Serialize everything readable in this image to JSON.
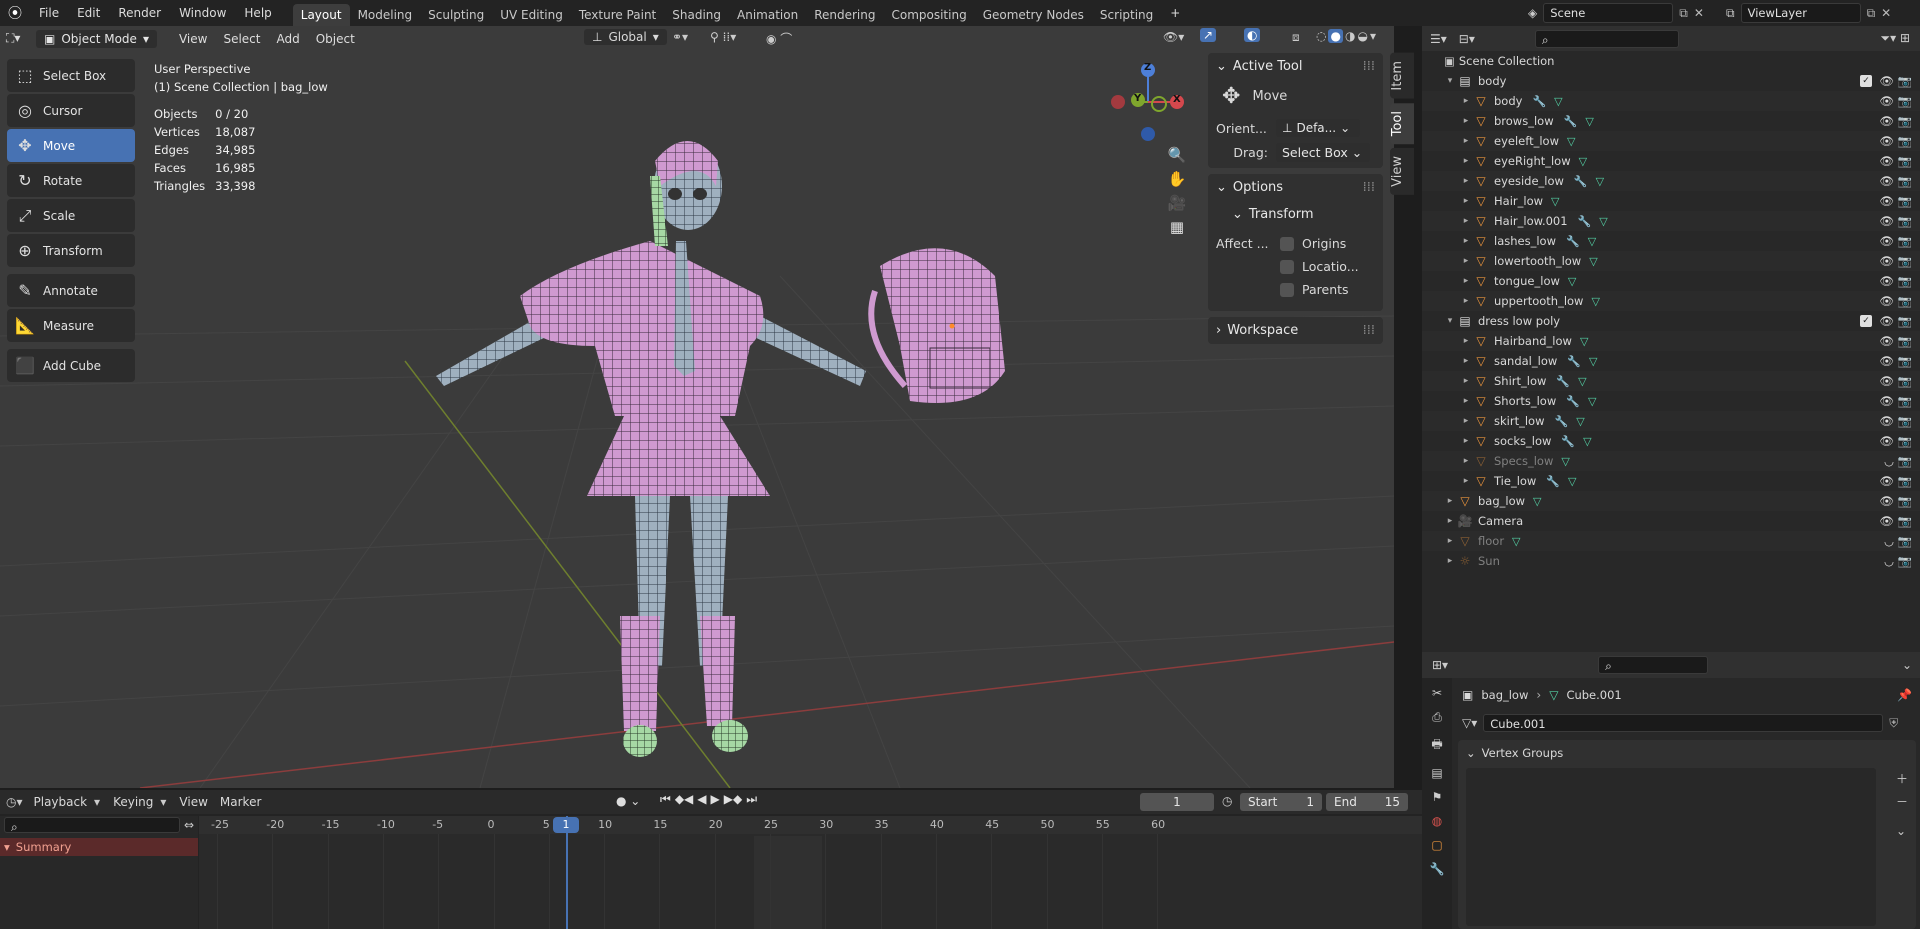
{
  "topbar": {
    "menus": [
      "File",
      "Edit",
      "Render",
      "Window",
      "Help"
    ],
    "workspaces": [
      "Layout",
      "Modeling",
      "Sculpting",
      "UV Editing",
      "Texture Paint",
      "Shading",
      "Animation",
      "Rendering",
      "Compositing",
      "Geometry Nodes",
      "Scripting"
    ],
    "active_workspace": "Layout",
    "add_tab": "+",
    "scene": "Scene",
    "view_layer": "ViewLayer"
  },
  "viewport": {
    "mode": "Object Mode",
    "menus": [
      "View",
      "Select",
      "Add",
      "Object"
    ],
    "orientation": "Global",
    "title": "User Perspective",
    "collection": "(1) Scene Collection | bag_low",
    "stats": [
      {
        "label": "Objects",
        "value": "0 / 20"
      },
      {
        "label": "Vertices",
        "value": "18,087"
      },
      {
        "label": "Edges",
        "value": "34,985"
      },
      {
        "label": "Faces",
        "value": "16,985"
      },
      {
        "label": "Triangles",
        "value": "33,398"
      }
    ],
    "gizmo": {
      "z": "Z",
      "y": "Y",
      "x": "X"
    }
  },
  "tools": [
    {
      "label": "Select Box",
      "icon": "select-box-icon",
      "glyph": "⬚",
      "active": false
    },
    {
      "label": "Cursor",
      "icon": "cursor-icon",
      "glyph": "◎",
      "active": false
    },
    {
      "label": "Move",
      "icon": "move-icon",
      "glyph": "✥",
      "active": true
    },
    {
      "label": "Rotate",
      "icon": "rotate-icon",
      "glyph": "↻",
      "active": false
    },
    {
      "label": "Scale",
      "icon": "scale-icon",
      "glyph": "⤢",
      "active": false
    },
    {
      "label": "Transform",
      "icon": "transform-icon",
      "glyph": "⊕",
      "active": false
    },
    {
      "label": "Annotate",
      "icon": "annotate-icon",
      "glyph": "✎",
      "active": false
    },
    {
      "label": "Measure",
      "icon": "measure-icon",
      "glyph": "📐",
      "active": false
    },
    {
      "label": "Add Cube",
      "icon": "add-cube-icon",
      "glyph": "⬛",
      "active": false
    }
  ],
  "npanel": {
    "active_tool_title": "Active Tool",
    "move_label": "Move",
    "orient_label": "Orient...",
    "orient_value": "Defa...",
    "drag_label": "Drag:",
    "drag_value": "Select Box",
    "options_title": "Options",
    "transform_title": "Transform",
    "affect_label": "Affect ...",
    "affect_options": [
      "Origins",
      "Locatio...",
      "Parents"
    ],
    "workspace_title": "Workspace",
    "tabs": [
      "Item",
      "Tool",
      "View"
    ]
  },
  "outliner": {
    "root": "Scene Collection",
    "rows": [
      {
        "label": "body",
        "depth": 1,
        "type": "collection",
        "check": true
      },
      {
        "label": "body",
        "depth": 2,
        "type": "mesh",
        "mod": true
      },
      {
        "label": "brows_low",
        "depth": 2,
        "type": "mesh",
        "mod": true
      },
      {
        "label": "eyeleft_low",
        "depth": 2,
        "type": "mesh",
        "mod": false
      },
      {
        "label": "eyeRight_low",
        "depth": 2,
        "type": "mesh",
        "mod": false
      },
      {
        "label": "eyeside_low",
        "depth": 2,
        "type": "mesh",
        "mod": true
      },
      {
        "label": "Hair_low",
        "depth": 2,
        "type": "mesh",
        "mod": false
      },
      {
        "label": "Hair_low.001",
        "depth": 2,
        "type": "mesh",
        "mod": true
      },
      {
        "label": "lashes_low",
        "depth": 2,
        "type": "mesh",
        "mod": true
      },
      {
        "label": "lowertooth_low",
        "depth": 2,
        "type": "mesh",
        "mod": false
      },
      {
        "label": "tongue_low",
        "depth": 2,
        "type": "mesh",
        "mod": false
      },
      {
        "label": "uppertooth_low",
        "depth": 2,
        "type": "mesh",
        "mod": false
      },
      {
        "label": "dress low poly",
        "depth": 1,
        "type": "collection",
        "check": true
      },
      {
        "label": "Hairband_low",
        "depth": 2,
        "type": "mesh",
        "mod": false
      },
      {
        "label": "sandal_low",
        "depth": 2,
        "type": "mesh",
        "mod": true
      },
      {
        "label": "Shirt_low",
        "depth": 2,
        "type": "mesh",
        "mod": true
      },
      {
        "label": "Shorts_low",
        "depth": 2,
        "type": "mesh",
        "mod": true
      },
      {
        "label": "skirt_low",
        "depth": 2,
        "type": "mesh",
        "mod": true
      },
      {
        "label": "socks_low",
        "depth": 2,
        "type": "mesh",
        "mod": true
      },
      {
        "label": "Specs_low",
        "depth": 2,
        "type": "mesh",
        "mod": false,
        "hidden": true
      },
      {
        "label": "Tie_low",
        "depth": 2,
        "type": "mesh",
        "mod": true
      },
      {
        "label": "bag_low",
        "depth": 1,
        "type": "mesh",
        "mod": false
      },
      {
        "label": "Camera",
        "depth": 1,
        "type": "camera",
        "mod": false
      },
      {
        "label": "floor",
        "depth": 1,
        "type": "mesh",
        "mod": false,
        "hidden": true
      },
      {
        "label": "Sun",
        "depth": 1,
        "type": "light",
        "mod": false,
        "hidden": true
      }
    ]
  },
  "properties": {
    "object": "bag_low",
    "data": "Cube.001",
    "data_field": "Cube.001",
    "vertex_groups": "Vertex Groups"
  },
  "timeline": {
    "menus": [
      "Playback",
      "Keying",
      "View",
      "Marker"
    ],
    "current_frame": "1",
    "start_label": "Start",
    "start": "1",
    "end_label": "End",
    "end": "15",
    "ruler": [
      "-25",
      "-20",
      "-15",
      "-10",
      "-5",
      "0",
      "5",
      "10",
      "15",
      "20",
      "25",
      "30",
      "35",
      "40",
      "45",
      "50",
      "55",
      "60"
    ],
    "playhead": "1",
    "summary": "Summary"
  }
}
